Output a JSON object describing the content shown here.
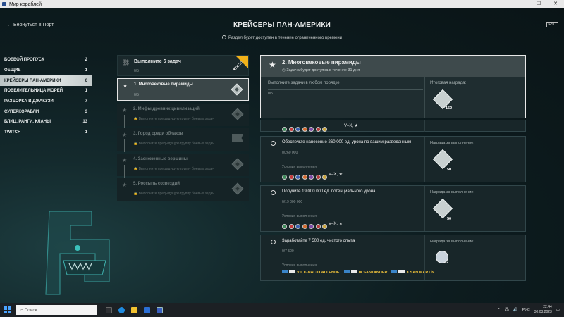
{
  "window": {
    "title": "Мир кораблей",
    "controls": [
      "—",
      "☐",
      "✕"
    ]
  },
  "header": {
    "back_label": "← Вернуться в Порт",
    "title": "КРЕЙСЕРЫ ПАН-АМЕРИКИ",
    "notice": "Раздел будет доступен в течение ограниченного времени",
    "close_label": "ESC"
  },
  "sidebar": {
    "items": [
      {
        "label": "БОЕВОЙ ПРОПУСК",
        "count": "2"
      },
      {
        "label": "ОБЩИЕ",
        "count": "1"
      },
      {
        "label": "КРЕЙСЕРЫ ПАН-АМЕРИКИ",
        "count": "6"
      },
      {
        "label": "ПОВЕЛИТЕЛЬНИЦА МОРЕЙ",
        "count": "1"
      },
      {
        "label": "РАЗБОРКА В ДЖАКУЗИ",
        "count": "7"
      },
      {
        "label": "СУПЕРКОРАБЛИ",
        "count": "3"
      },
      {
        "label": "БЛИЦ, РАНГИ, КЛАНЫ",
        "count": "13"
      },
      {
        "label": "TWITCH",
        "count": "1"
      }
    ],
    "active_index": 2
  },
  "chain": {
    "header": {
      "title": "Выполните 6 задач",
      "progress": "0/5"
    },
    "tasks": [
      {
        "title": "1. Многовековые пирамиды",
        "progress": "0/5",
        "locked": false
      },
      {
        "title": "2. Мифы древних цивилизаций",
        "lock_text": "Выполните предыдущую группу боевых задач",
        "locked": true
      },
      {
        "title": "3. Город среди облаков",
        "lock_text": "Выполните предыдущую группу боевых задач",
        "locked": true
      },
      {
        "title": "4. Заснеженные вершины",
        "lock_text": "Выполните предыдущую группу боевых задач",
        "locked": true
      },
      {
        "title": "5. Россыпь созвездий",
        "lock_text": "Выполните предыдущую группу боевых задач",
        "locked": true
      }
    ]
  },
  "detail": {
    "title": "2. Многовековые пирамиды",
    "availability": "Задача будет доступна в течение 31 дня",
    "subtitle": "Выполните задачи в любом порядке",
    "progress": "0/5",
    "reward_label": "Итоговая награда:",
    "reward_count": "150",
    "partial_tier": "V–X, ★"
  },
  "conditions": [
    {
      "title": "Обеспечьте нанесение 260 000 ед. урона по вашим разведанным",
      "progress": "0/260 000",
      "cond_label": "Условия выполнения",
      "tier": "V–X, ★",
      "reward_label": "Награда за выполнение:",
      "reward_count": "50"
    },
    {
      "title": "Получите 19 000 000 ед. потенциального урона",
      "progress": "0/19 000 000",
      "cond_label": "Условия выполнения",
      "tier": "V–X, ★",
      "reward_label": "Награда за выполнение:",
      "reward_count": "50"
    },
    {
      "title": "Заработайте 7 500 ед. чистого опыта",
      "progress": "0/7 500",
      "cond_label": "Условия выполнения",
      "ships": [
        "VIII IGNACIO ALLENDE",
        "IX SANTANDER",
        "X SAN MARTÍN"
      ],
      "reward_label": "Награда за выполнение:",
      "reward_count": "2"
    }
  ],
  "nation_icon_colors": [
    "#3f8a5a",
    "#c43b3b",
    "#3a5fb0",
    "#d46b2e",
    "#7d4aa8",
    "#b03a3a",
    "#c9a43b"
  ],
  "taskbar": {
    "search_placeholder": "Поиск",
    "language": "РУС",
    "time": "22:44",
    "date": "30.03.2023"
  }
}
